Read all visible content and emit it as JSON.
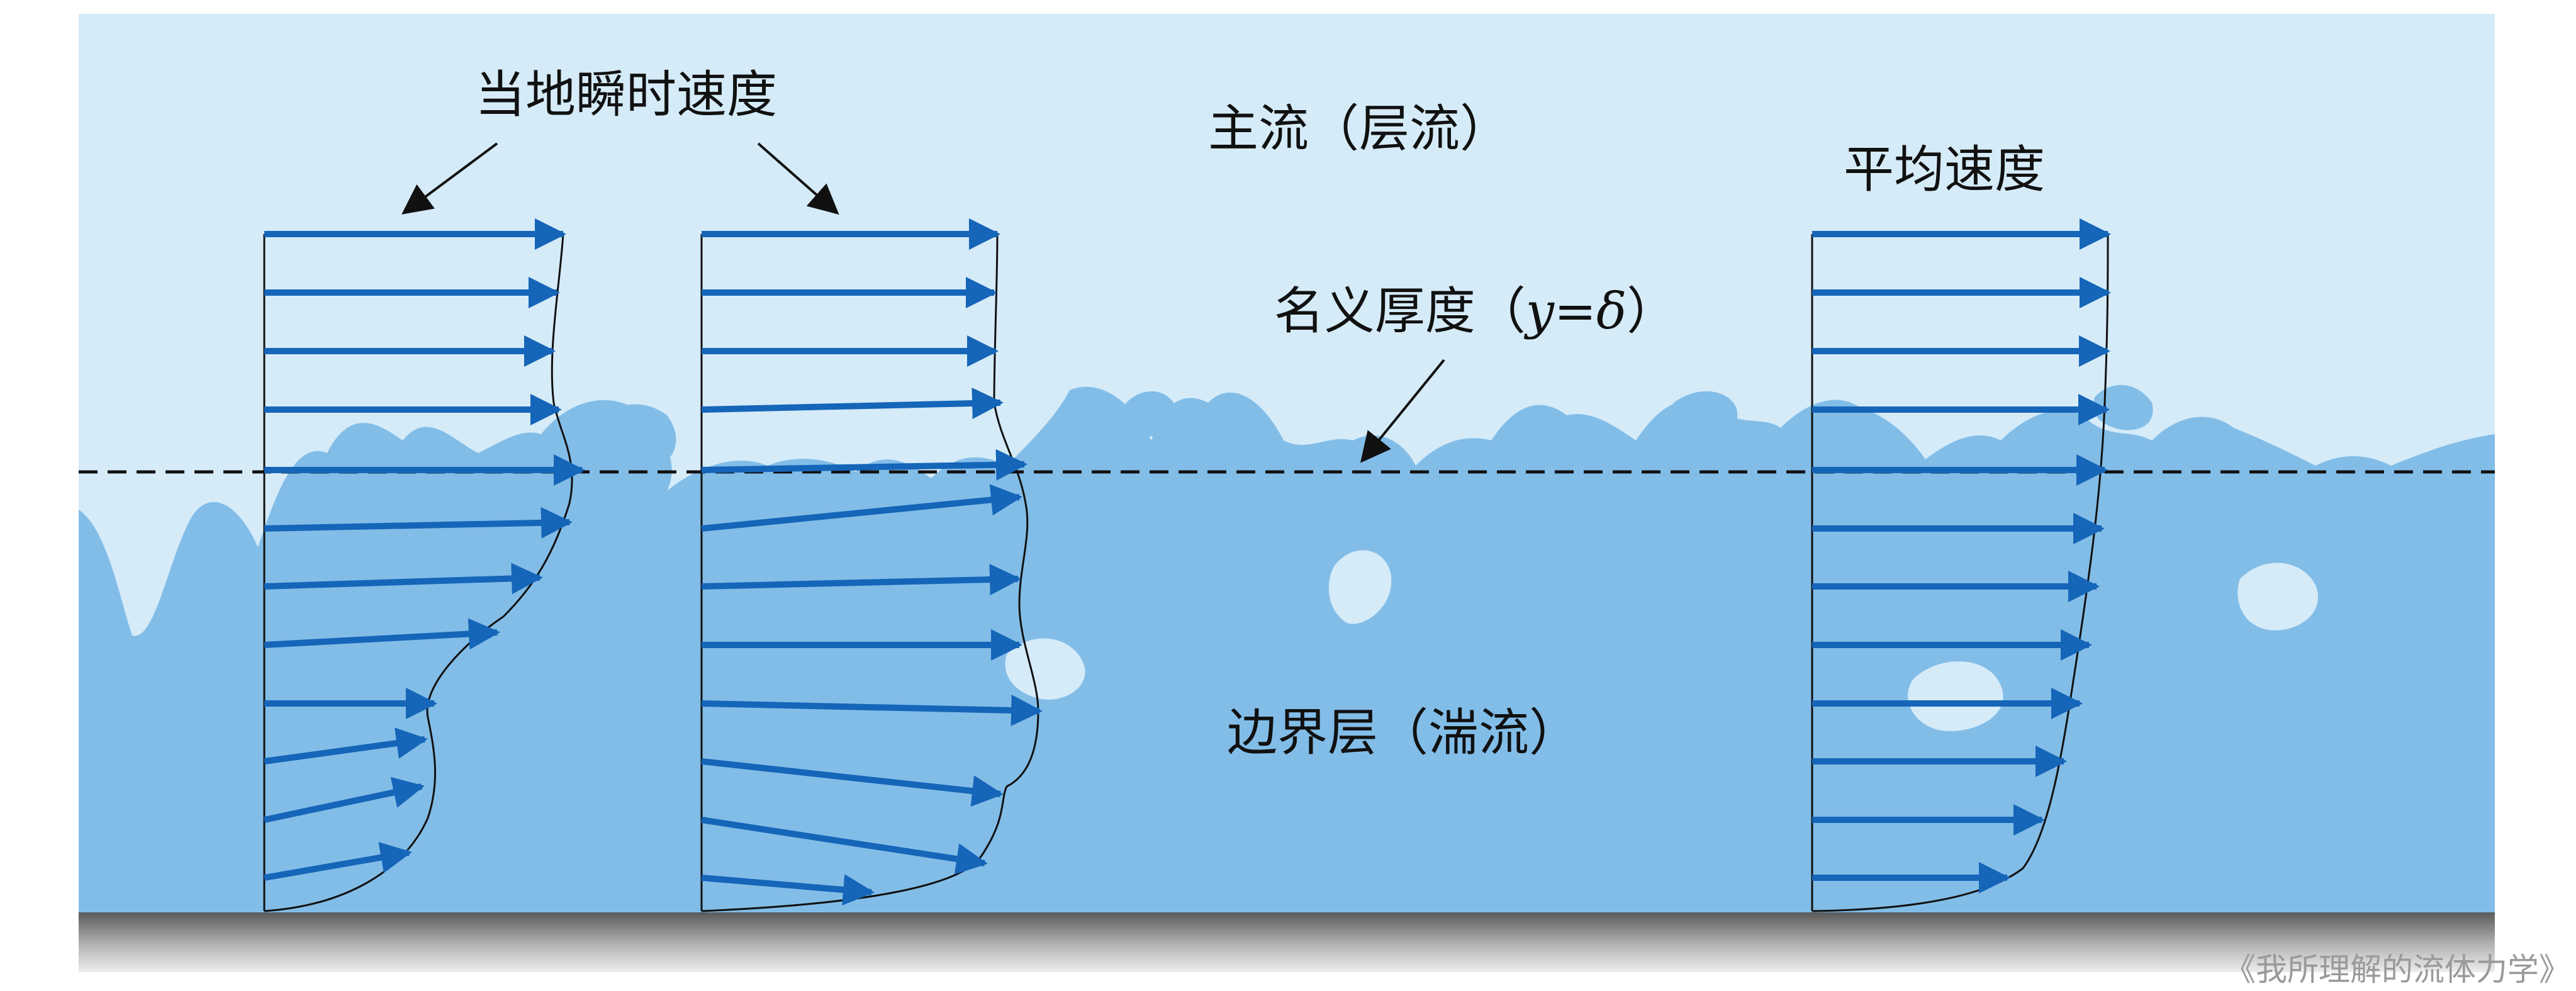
{
  "labels": {
    "instantaneous_velocity": "当地瞬时速度",
    "main_flow": "主流（层流）",
    "average_velocity": "平均速度",
    "nominal_thickness_prefix": "名义厚度（",
    "nominal_thickness_y": "y",
    "nominal_thickness_eq": "=δ",
    "nominal_thickness_suffix": "）",
    "boundary_layer": "边界层（湍流）",
    "credit": "《我所理解的流体力学》"
  },
  "colors": {
    "main_flow_fill": "#d5ebf8",
    "turbulent_fill": "#82bde8",
    "arrow": "#1565b8",
    "wall_top": "#5f5f5f",
    "wall_bottom": "#e6e6e6",
    "line": "#111111"
  }
}
